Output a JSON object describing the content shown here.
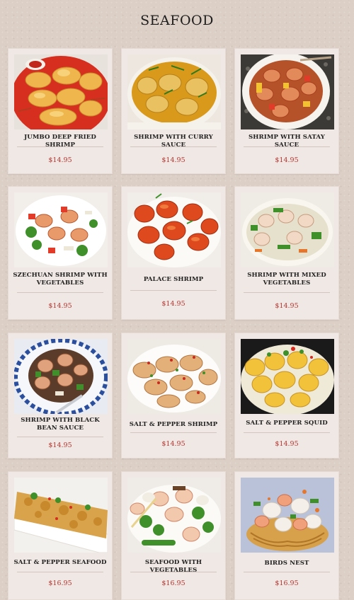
{
  "page": {
    "title": "SEAFOOD"
  },
  "colors": {
    "price": "#b3332e",
    "card_bg": "#f0e8e4",
    "page_bg": "#dccfc6"
  },
  "items": [
    {
      "name": "JUMBO DEEP FRIED SHRIMP",
      "price": "$14.95",
      "image": "fried-shrimp-photo"
    },
    {
      "name": "SHRIMP WITH CURRY SAUCE",
      "price": "$14.95",
      "image": "curry-shrimp-photo"
    },
    {
      "name": "SHRIMP WITH SATAY SAUCE",
      "price": "$14.95",
      "image": "satay-shrimp-photo"
    },
    {
      "name": "SZECHUAN SHRIMP WITH VEGETABLES",
      "price": "$14.95",
      "image": "szechuan-shrimp-photo"
    },
    {
      "name": "PALACE SHRIMP",
      "price": "$14.95",
      "image": "palace-shrimp-photo"
    },
    {
      "name": "SHRIMP WITH MIXED VEGETABLES",
      "price": "$14.95",
      "image": "mixed-veg-shrimp-photo"
    },
    {
      "name": "SHRIMP WITH BLACK BEAN SAUCE",
      "price": "$14.95",
      "image": "black-bean-shrimp-photo"
    },
    {
      "name": "SALT & PEPPER SHRIMP",
      "price": "$14.95",
      "image": "salt-pepper-shrimp-photo"
    },
    {
      "name": "SALT & PEPPER SQUID",
      "price": "$14.95",
      "image": "salt-pepper-squid-photo"
    },
    {
      "name": "SALT & PEPPER SEAFOOD",
      "price": "$16.95",
      "image": "salt-pepper-seafood-photo"
    },
    {
      "name": "SEAFOOD WITH VEGETABLES",
      "price": "$16.95",
      "image": "seafood-vegetables-photo"
    },
    {
      "name": "BIRDS NEST",
      "price": "$16.95",
      "image": "birds-nest-photo"
    }
  ]
}
